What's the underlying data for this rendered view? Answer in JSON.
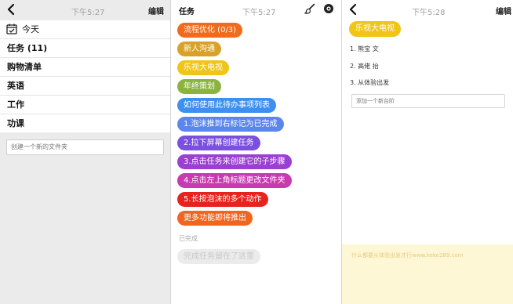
{
  "status": {
    "time_1": "下午5:27",
    "time_2": "下午5:27",
    "time_3": "下午5:28"
  },
  "folders_panel": {
    "edit_label": "编辑",
    "items": [
      {
        "label": "今天",
        "bold": false
      },
      {
        "label": "任务 (11)",
        "bold": true
      },
      {
        "label": "购物清单",
        "bold": false
      },
      {
        "label": "英语",
        "bold": false
      },
      {
        "label": "工作",
        "bold": false
      },
      {
        "label": "功课",
        "bold": false
      }
    ],
    "new_folder_placeholder": "创建一个新的文件夹"
  },
  "tasks_panel": {
    "title": "任务",
    "tasks": [
      {
        "label": "流程优化 (0/3)",
        "color": "#f26a1b"
      },
      {
        "label": "新人沟通",
        "color": "#d9a127"
      },
      {
        "label": "乐视大电视",
        "color": "#f0c518"
      },
      {
        "label": "年终策划",
        "color": "#8ab33f"
      },
      {
        "label": "如何使用此待办事项列表",
        "color": "#3d8ff0"
      },
      {
        "label": "1.泡沫推到右标记为已完成",
        "color": "#5a86ee"
      },
      {
        "label": "2.拉下屏幕创建任务",
        "color": "#7b4fe0"
      },
      {
        "label": "3.点击任务来创建它的子步骤",
        "color": "#9b3fd3"
      },
      {
        "label": "4.点击左上角标题更改文件夹",
        "color": "#c73ab0"
      },
      {
        "label": "5.长按泡沫的多个动作",
        "color": "#e8221c"
      },
      {
        "label": "更多功能即将推出",
        "color": "#f2651d"
      }
    ],
    "completed_label": "已完成",
    "completed_tasks": [
      {
        "label": "完成任务留在了这里"
      }
    ]
  },
  "detail_panel": {
    "edit_label": "编辑",
    "task_title": "乐视大电视",
    "subtasks": [
      "1. 熊宝 文",
      "2. 高佬 抬",
      "3. 从体验出发"
    ],
    "add_subtask_placeholder": "添加一个新台阶",
    "footer_text": "什么都要从体验出发才行www.keke289.com"
  }
}
